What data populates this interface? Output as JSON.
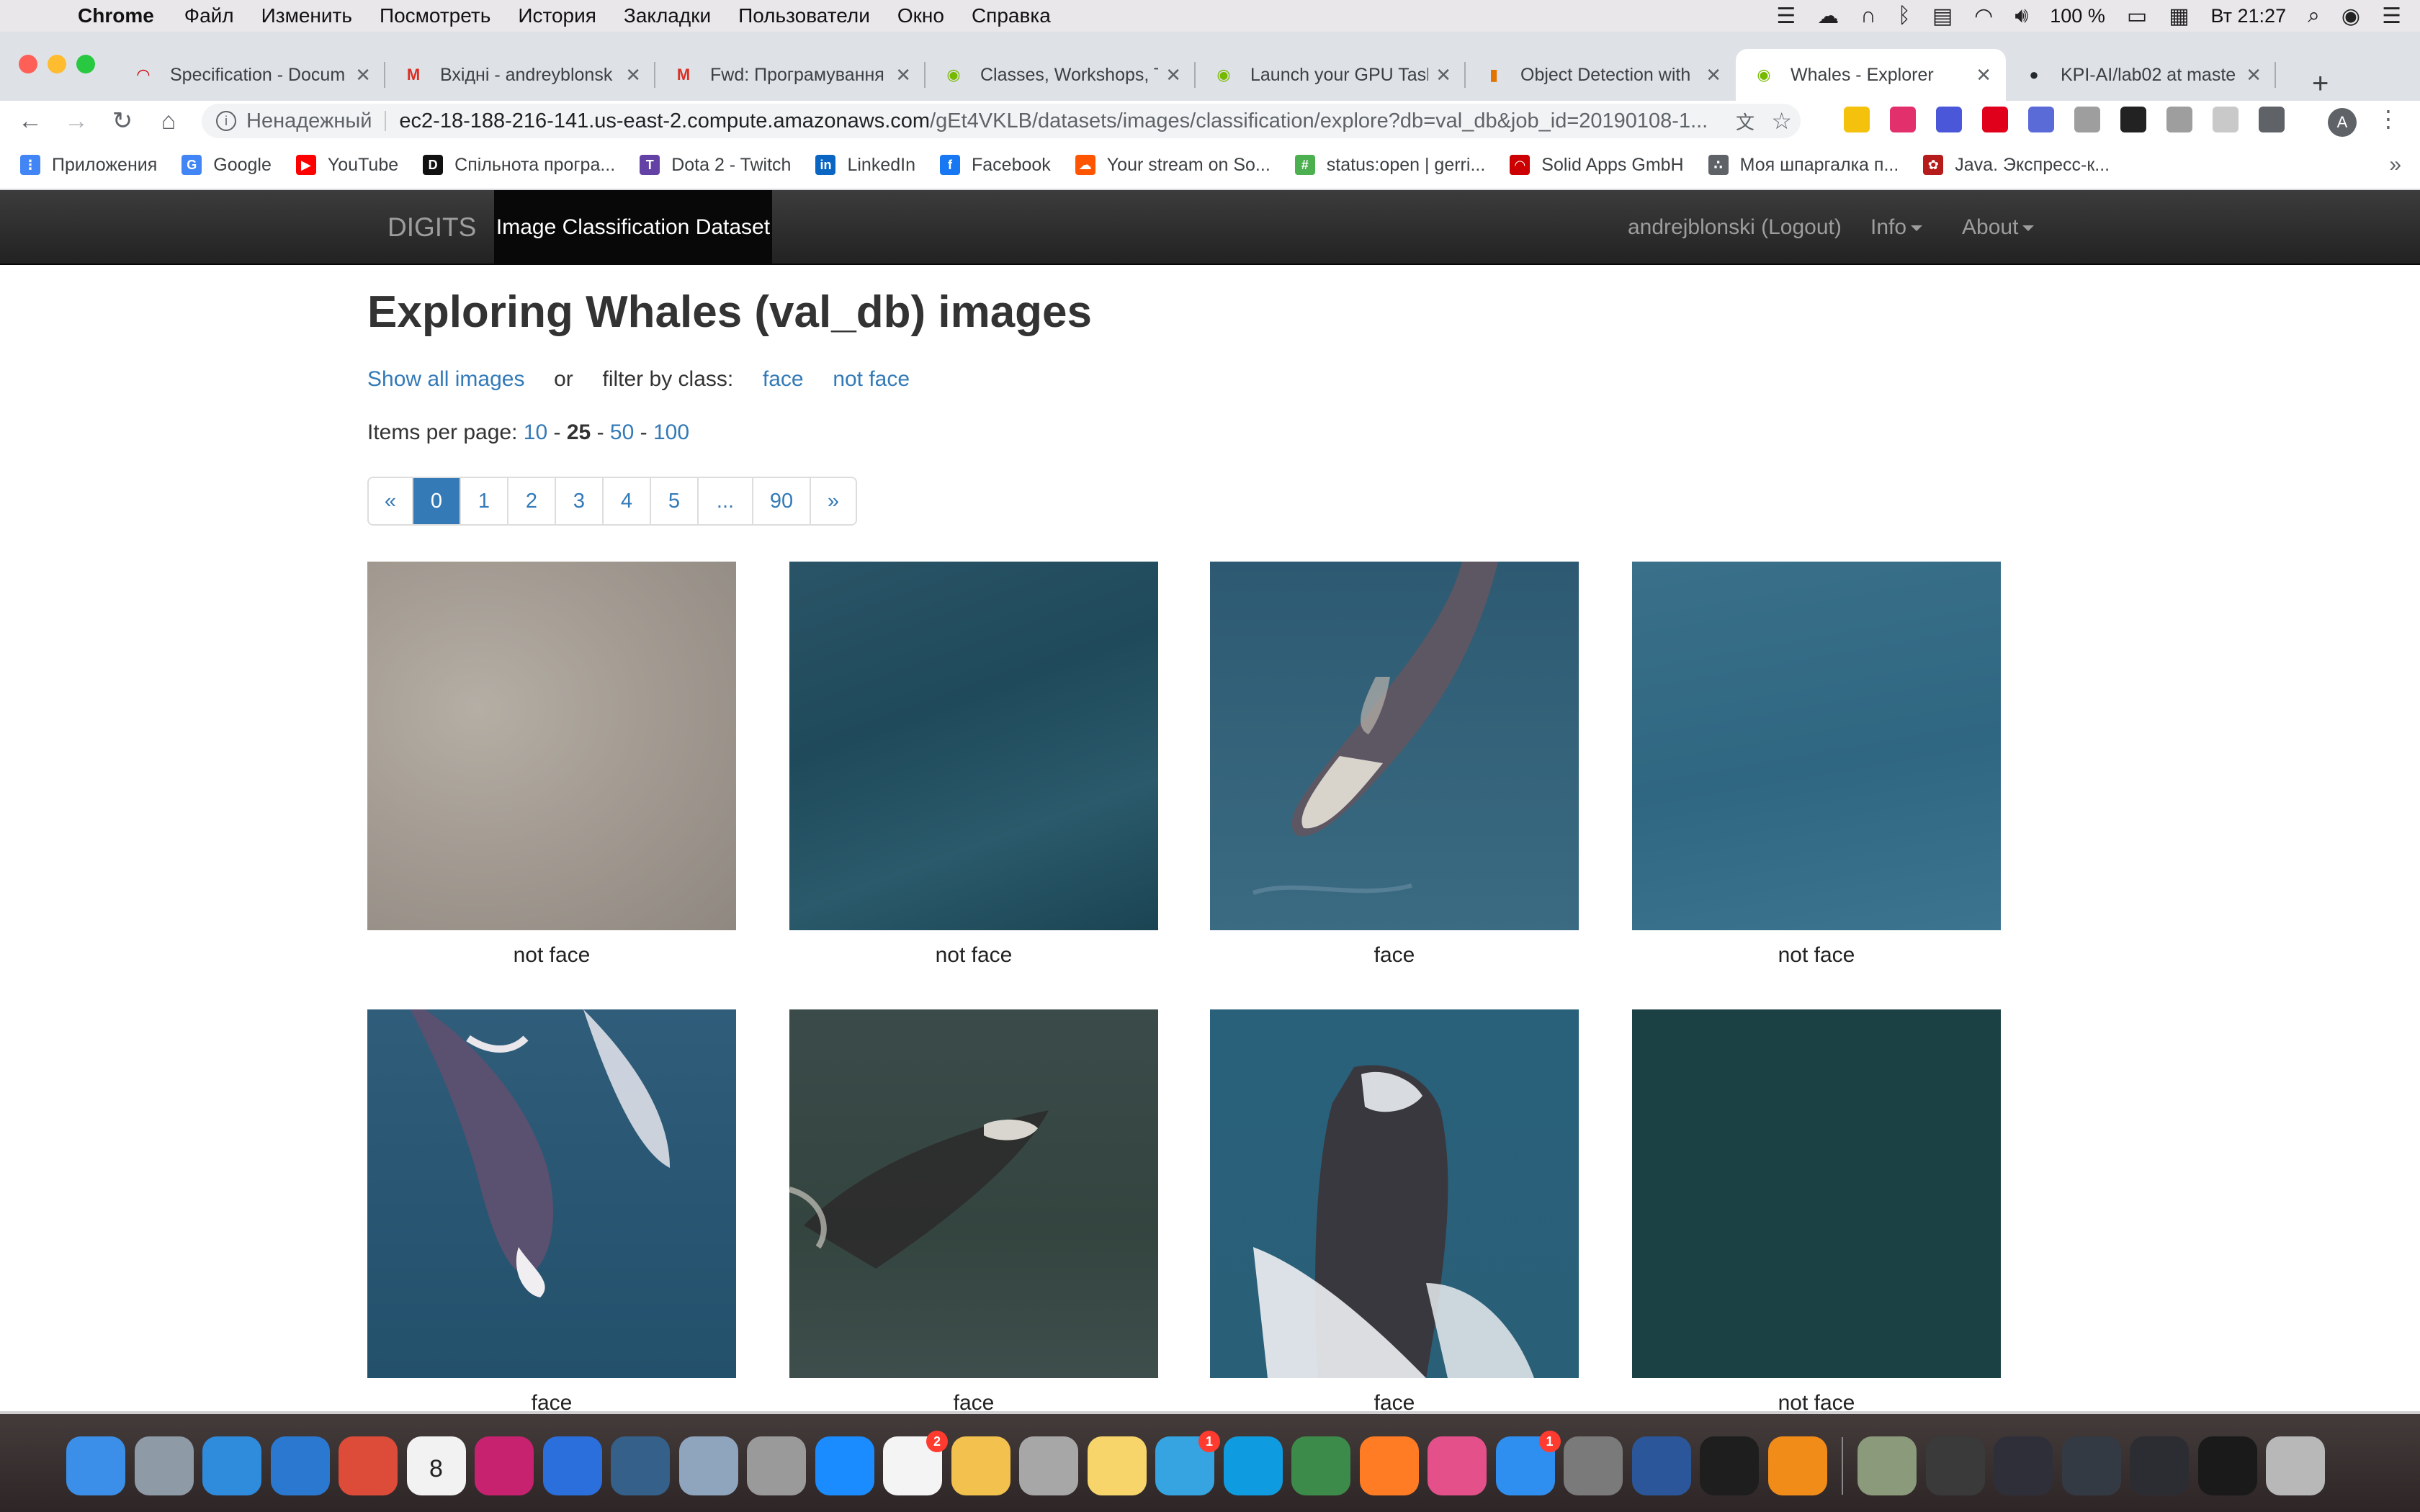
{
  "menubar": {
    "app_name": "Chrome",
    "items": [
      "Файл",
      "Изменить",
      "Посмотреть",
      "История",
      "Закладки",
      "Пользователи",
      "Окно",
      "Справка"
    ],
    "battery": "100 %",
    "clock": "Вт 21:27"
  },
  "tabs": [
    {
      "title": "Specification - Docum",
      "icon": "redhat-icon",
      "color": "#cc0000",
      "glyph": "◠"
    },
    {
      "title": "Вхідні - andreyblonsk",
      "icon": "gmail-icon",
      "color": "#d93025",
      "glyph": "M"
    },
    {
      "title": "Fwd: Програмування",
      "icon": "gmail-icon",
      "color": "#d93025",
      "glyph": "M"
    },
    {
      "title": "Classes, Workshops, T",
      "icon": "nvidia-icon",
      "color": "#76b900",
      "glyph": "◉"
    },
    {
      "title": "Launch your GPU Tasl",
      "icon": "nvidia-icon",
      "color": "#76b900",
      "glyph": "◉"
    },
    {
      "title": "Object Detection with",
      "icon": "bookmark-icon",
      "color": "#e37400",
      "glyph": "▮"
    },
    {
      "title": "Whales - Explorer",
      "icon": "nvidia-icon",
      "color": "#76b900",
      "glyph": "◉"
    },
    {
      "title": "KPI-AI/lab02 at maste",
      "icon": "github-icon",
      "color": "#24292e",
      "glyph": "●"
    }
  ],
  "omnibox": {
    "security_label": "Ненадежный",
    "host": "ec2-18-188-216-141.us-east-2.compute.amazonaws.com",
    "path": "/gEt4VKLB/datasets/images/classification/explore?db=val_db&job_id=20190108-1..."
  },
  "bookmarks": [
    {
      "label": "Приложения",
      "icon": "apps-grid-icon",
      "color": "#4285f4",
      "glyph": "⋮"
    },
    {
      "label": "Google",
      "icon": "google-icon",
      "color": "#4285f4",
      "glyph": "G"
    },
    {
      "label": "YouTube",
      "icon": "youtube-icon",
      "color": "#ff0000",
      "glyph": "▶"
    },
    {
      "label": "Спільнота програ...",
      "icon": "dou-icon",
      "color": "#111111",
      "glyph": "D"
    },
    {
      "label": "Dota 2 - Twitch",
      "icon": "twitch-icon",
      "color": "#6441a5",
      "glyph": "T"
    },
    {
      "label": "LinkedIn",
      "icon": "linkedin-icon",
      "color": "#0a66c2",
      "glyph": "in"
    },
    {
      "label": "Facebook",
      "icon": "facebook-icon",
      "color": "#1877f2",
      "glyph": "f"
    },
    {
      "label": "Your stream on So...",
      "icon": "soundcloud-icon",
      "color": "#ff5500",
      "glyph": "☁"
    },
    {
      "label": "status:open | gerri...",
      "icon": "gerrit-icon",
      "color": "#4caf50",
      "glyph": "#"
    },
    {
      "label": "Solid Apps GmbH",
      "icon": "redhat-icon",
      "color": "#cc0000",
      "glyph": "◠"
    },
    {
      "label": "Моя шпаргалка п...",
      "icon": "dots-icon",
      "color": "#5f6368",
      "glyph": "∴"
    },
    {
      "label": "Java. Экспресс-к...",
      "icon": "paw-icon",
      "color": "#b71c1c",
      "glyph": "✿"
    }
  ],
  "navbar": {
    "brand": "DIGITS",
    "active": "Image Classification Dataset",
    "user": "andrejblonski (Logout)",
    "info": "Info",
    "about": "About"
  },
  "page": {
    "title": "Exploring Whales (val_db) images",
    "show_all": "Show all images",
    "or": "or",
    "filter_label": "filter by class:",
    "class_face": "face",
    "class_not_face": "not face",
    "per_page_label": "Items per page:",
    "per_page_options": [
      "10",
      "25",
      "50",
      "100"
    ],
    "per_page_selected": "25",
    "per_page_sep": "-"
  },
  "pagination": [
    "«",
    "0",
    "1",
    "2",
    "3",
    "4",
    "5",
    "...",
    "90",
    "»"
  ],
  "pagination_active": "0",
  "images": [
    {
      "label": "not face"
    },
    {
      "label": "not face"
    },
    {
      "label": "face"
    },
    {
      "label": "not face"
    },
    {
      "label": "face"
    },
    {
      "label": "face"
    },
    {
      "label": "face"
    },
    {
      "label": "not face"
    }
  ],
  "dock": {
    "items": [
      {
        "name": "finder-icon",
        "color": "#3b8fe8"
      },
      {
        "name": "launchpad-icon",
        "color": "#8e9aa6"
      },
      {
        "name": "safari-icon",
        "color": "#2f8bdb"
      },
      {
        "name": "navigation-icon",
        "color": "#2a78d0"
      },
      {
        "name": "chrome-icon",
        "color": "#dd4b39"
      },
      {
        "name": "calendar-icon",
        "color": "#f2f2f2",
        "text": "8"
      },
      {
        "name": "intellij-icon",
        "color": "#c6226f"
      },
      {
        "name": "xcode-icon",
        "color": "#2a6fdb"
      },
      {
        "name": "mysql-workbench-icon",
        "color": "#35608a"
      },
      {
        "name": "postgres-icon",
        "color": "#8fa5bd"
      },
      {
        "name": "database-icon",
        "color": "#9a9a9a"
      },
      {
        "name": "shazam-icon",
        "color": "#1a8cff"
      },
      {
        "name": "reminders-icon",
        "color": "#f4f4f4",
        "badge": "2"
      },
      {
        "name": "photos-icon",
        "color": "#f2c14e"
      },
      {
        "name": "calculator-icon",
        "color": "#a7a7a7"
      },
      {
        "name": "notes-icon",
        "color": "#f7d56a"
      },
      {
        "name": "telegram-icon",
        "color": "#35a4e0",
        "badge": "1"
      },
      {
        "name": "skype-icon",
        "color": "#0f9be0"
      },
      {
        "name": "pycharm-icon",
        "color": "#3d8b4a"
      },
      {
        "name": "firefox-icon",
        "color": "#ff7b24"
      },
      {
        "name": "itunes-icon",
        "color": "#e4508a"
      },
      {
        "name": "app-store-icon",
        "color": "#2f8ff0",
        "badge": "1"
      },
      {
        "name": "system-prefs-icon",
        "color": "#7a7a7a"
      },
      {
        "name": "word-icon",
        "color": "#2b579a"
      },
      {
        "name": "terminal-icon",
        "color": "#1e1e1e"
      },
      {
        "name": "sublime-icon",
        "color": "#f28c18"
      }
    ],
    "right_items": [
      {
        "name": "preview-window-1",
        "color": "#8a9a7a"
      },
      {
        "name": "preview-window-2",
        "color": "#3a3a3a"
      },
      {
        "name": "preview-window-3",
        "color": "#2f2f3a"
      },
      {
        "name": "preview-window-4",
        "color": "#343a44"
      },
      {
        "name": "preview-window-5",
        "color": "#2c2c33"
      },
      {
        "name": "preview-window-6",
        "color": "#1a1a1a"
      },
      {
        "name": "trash-icon",
        "color": "#b8b8b8"
      }
    ]
  }
}
